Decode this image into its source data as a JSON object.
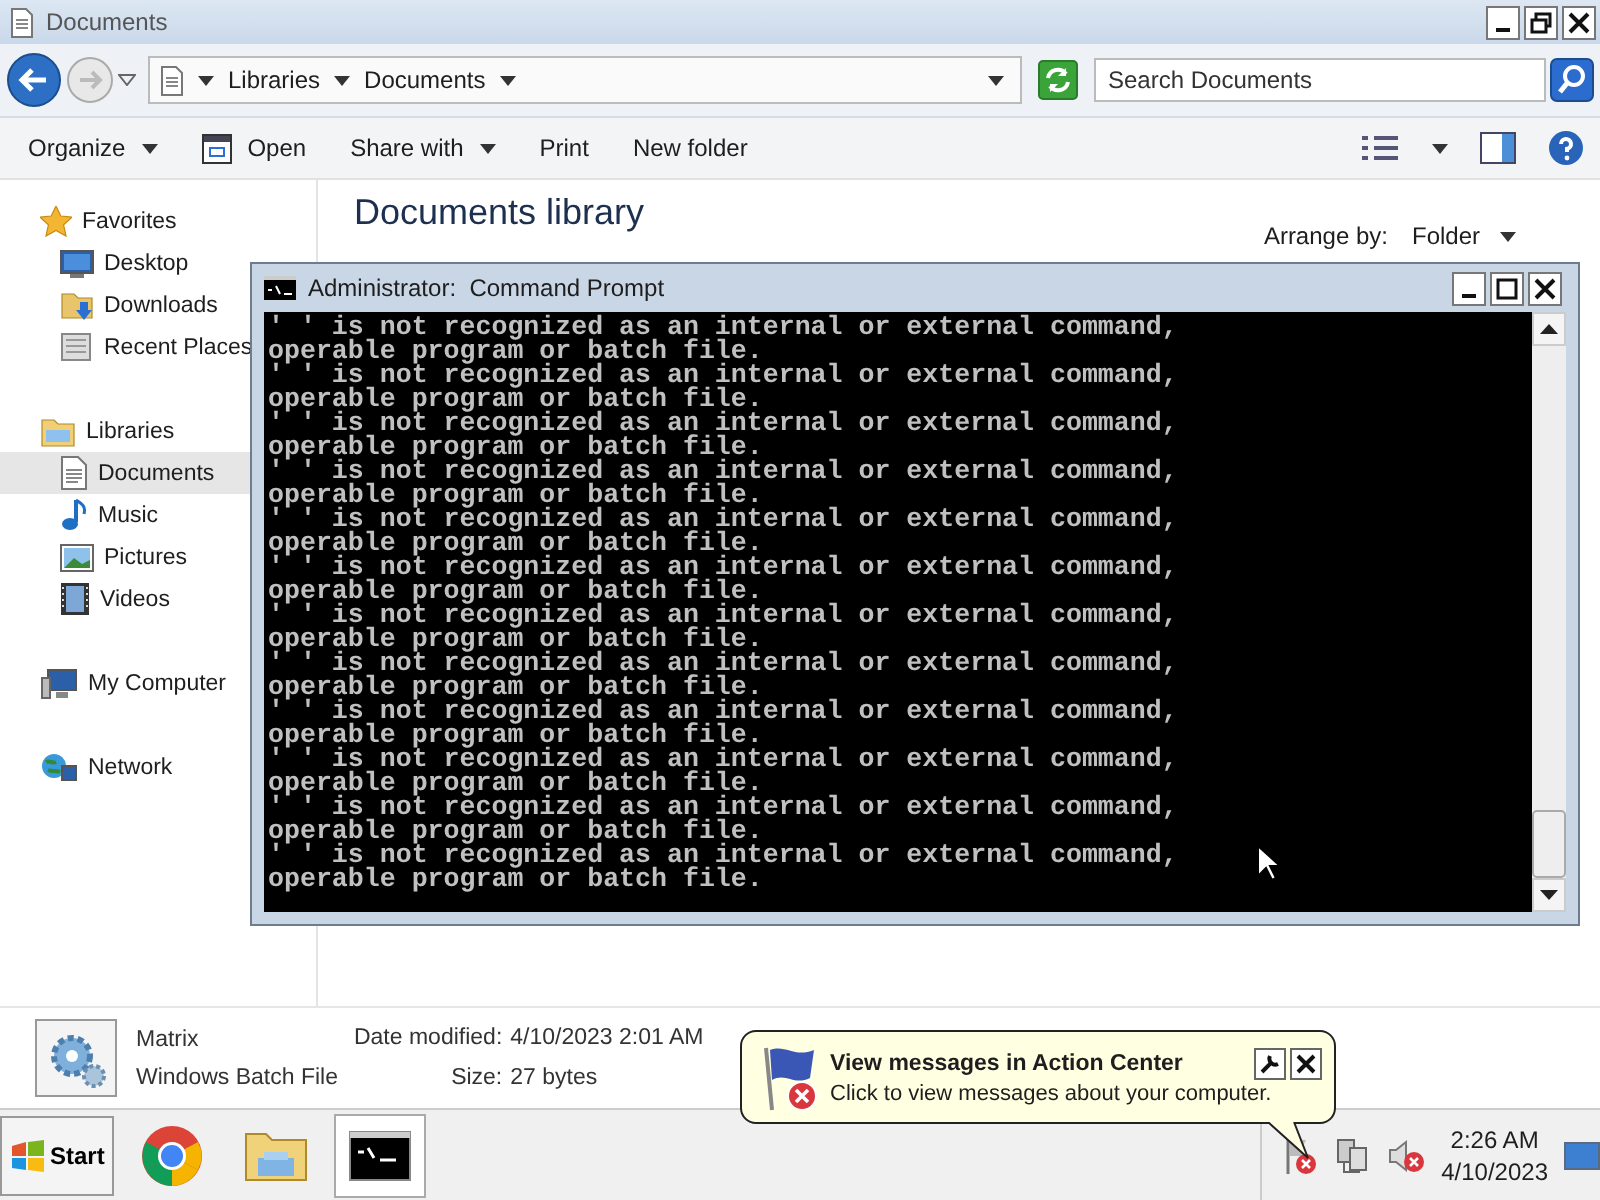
{
  "explorer": {
    "title": "Documents",
    "breadcrumb": [
      "Libraries",
      "Documents"
    ],
    "search": {
      "placeholder": "Search Documents"
    },
    "toolbar": [
      {
        "label": "Organize",
        "kind": "menu"
      },
      {
        "label": "Open",
        "kind": "icon"
      },
      {
        "label": "Share with",
        "kind": "menu"
      },
      {
        "label": "Print",
        "kind": "plain"
      },
      {
        "label": "New folder",
        "kind": "plain"
      }
    ],
    "nav": [
      {
        "label": "Favorites",
        "selected": false,
        "children": [
          {
            "label": "Desktop",
            "selected": false
          },
          {
            "label": "Downloads",
            "selected": false
          },
          {
            "label": "Recent Places",
            "selected": false
          }
        ]
      },
      {
        "label": "Libraries",
        "selected": false,
        "children": [
          {
            "label": "Documents",
            "selected": true
          },
          {
            "label": "Music",
            "selected": false
          },
          {
            "label": "Pictures",
            "selected": false
          },
          {
            "label": "Videos",
            "selected": false
          }
        ]
      },
      {
        "label": "My Computer",
        "selected": false
      },
      {
        "label": "Network",
        "selected": false
      }
    ],
    "library": {
      "title": "Documents library",
      "arrange_label": "Arrange by:",
      "arrange_value": "Folder"
    },
    "details": {
      "name": "Matrix",
      "type": "Windows Batch File",
      "fields": [
        {
          "label": "Date modified:",
          "value": "4/10/2023 2:01 AM"
        },
        {
          "label": "Size:",
          "value": "27 bytes"
        }
      ]
    }
  },
  "console": {
    "title": "Administrator:  Command Prompt",
    "lines": [
      "' ' is not recognized as an internal or external command,",
      "operable program or batch file.",
      "' ' is not recognized as an internal or external command,",
      "operable program or batch file.",
      "' ' is not recognized as an internal or external command,",
      "operable program or batch file.",
      "' ' is not recognized as an internal or external command,",
      "operable program or batch file.",
      "' ' is not recognized as an internal or external command,",
      "operable program or batch file.",
      "' ' is not recognized as an internal or external command,",
      "operable program or batch file.",
      "' ' is not recognized as an internal or external command,",
      "operable program or batch file.",
      "' ' is not recognized as an internal or external command,",
      "operable program or batch file.",
      "' ' is not recognized as an internal or external command,",
      "operable program or batch file.",
      "' ' is not recognized as an internal or external command,",
      "operable program or batch file.",
      "' ' is not recognized as an internal or external command,",
      "operable program or batch file.",
      "' ' is not recognized as an internal or external command,",
      "operable program or batch file."
    ]
  },
  "notification": {
    "title": "View messages in Action Center",
    "message": "Click to view messages about your computer."
  },
  "taskbar": {
    "start": "Start",
    "apps": [
      {
        "selected": false
      },
      {
        "selected": false
      },
      {
        "selected": true
      }
    ],
    "clock": {
      "time": "2:26 AM",
      "date": "4/10/2023"
    }
  }
}
